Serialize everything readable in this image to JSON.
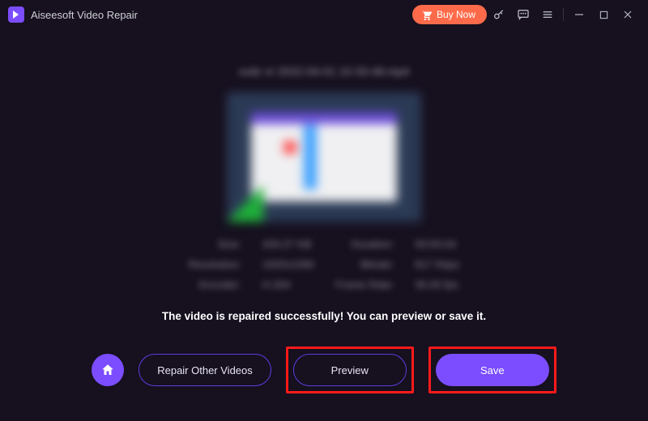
{
  "app": {
    "title": "Aiseesoft Video Repair"
  },
  "titlebar": {
    "buy_label": "Buy Now"
  },
  "file": {
    "name": "xxdc vr 2022-04-01 10-33-48.mp4"
  },
  "meta": {
    "size_label": "Size:",
    "size_value": "429.27 KB",
    "duration_label": "Duration:",
    "duration_value": "00:00:04",
    "resolution_label": "Resolution:",
    "resolution_value": "1920x1080",
    "bitrate_label": "Bitrate:",
    "bitrate_value": "817 Kbps",
    "encoder_label": "Encoder:",
    "encoder_value": "H.264",
    "framerate_label": "Frame Rate:",
    "framerate_value": "30.00 fps"
  },
  "status": {
    "message": "The video is repaired successfully! You can preview or save it."
  },
  "buttons": {
    "repair_other": "Repair Other Videos",
    "preview": "Preview",
    "save": "Save"
  }
}
